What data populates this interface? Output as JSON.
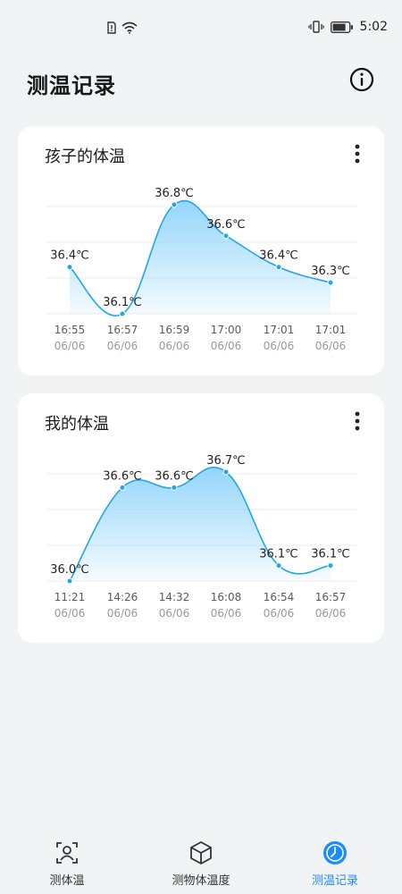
{
  "status_bar": {
    "time": "5:02",
    "icons": [
      "sim-alert-icon",
      "wifi-icon",
      "vibrate-icon",
      "battery-icon"
    ]
  },
  "header": {
    "title": "测温记录",
    "info_icon": "info-icon"
  },
  "cards": [
    {
      "id": "card-child",
      "title": "孩子的体温",
      "more_icon": "more-vertical-icon",
      "chart_data": {
        "type": "area",
        "categories": [
          "16:55",
          "16:57",
          "16:59",
          "17:00",
          "17:01",
          "17:01"
        ],
        "dates": [
          "06/06",
          "06/06",
          "06/06",
          "06/06",
          "06/06",
          "06/06"
        ],
        "values": [
          36.4,
          36.1,
          36.8,
          36.6,
          36.4,
          36.3
        ],
        "labels": [
          "36.4℃",
          "36.1℃",
          "36.8℃",
          "36.6℃",
          "36.4℃",
          "36.3℃"
        ],
        "ylim": [
          36.1,
          36.8
        ],
        "grid": true
      }
    },
    {
      "id": "card-me",
      "title": "我的体温",
      "more_icon": "more-vertical-icon",
      "chart_data": {
        "type": "area",
        "categories": [
          "11:21",
          "14:26",
          "14:32",
          "16:08",
          "16:54",
          "16:57"
        ],
        "dates": [
          "06/06",
          "06/06",
          "06/06",
          "06/06",
          "06/06",
          "06/06"
        ],
        "values": [
          36.0,
          36.6,
          36.6,
          36.7,
          36.1,
          36.1
        ],
        "labels": [
          "36.0℃",
          "36.6℃",
          "36.6℃",
          "36.7℃",
          "36.1℃",
          "36.1℃"
        ],
        "ylim": [
          36.0,
          36.7
        ],
        "grid": true
      }
    }
  ],
  "tabs": [
    {
      "label": "测体温",
      "icon": "person-scan-icon",
      "active": false
    },
    {
      "label": "测物体温度",
      "icon": "cube-icon",
      "active": false
    },
    {
      "label": "测温记录",
      "icon": "clock-icon",
      "active": true
    }
  ],
  "colors": {
    "accent": "#1a8cff",
    "line": "#22a7e6",
    "fill_top": "#8fd3fb",
    "card": "#ffffff",
    "background": "#f1f3f5"
  }
}
